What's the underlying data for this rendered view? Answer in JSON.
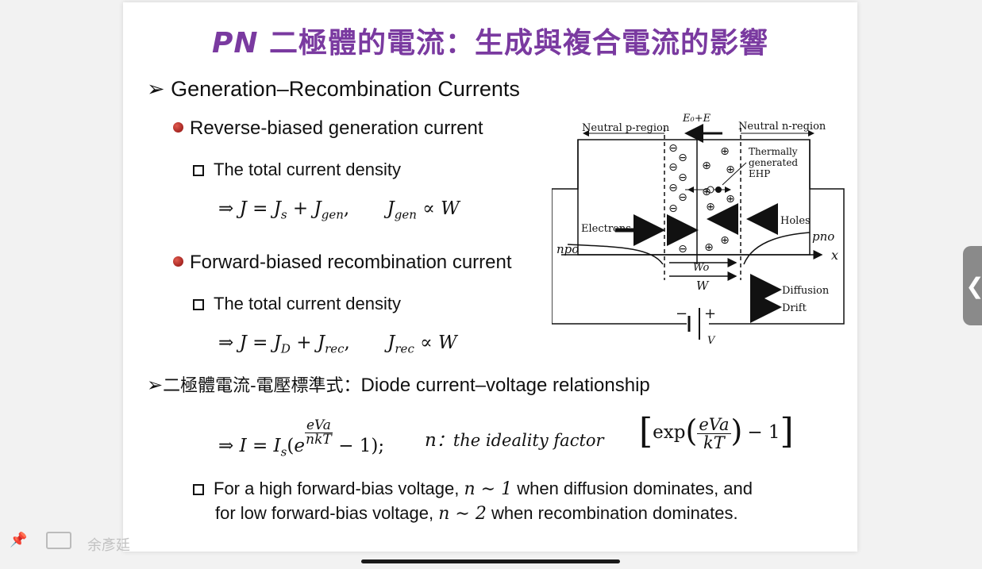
{
  "slide": {
    "title_pn": "PN",
    "title_rest": " 二極體的電流：生成與複合電流的影響",
    "heading": "Generation–Recombination Currents",
    "reverse": {
      "label": "Reverse-biased generation current",
      "sub": "The total current density",
      "eq_main": "⇒ J = J",
      "eq_s": "s",
      "eq_plus": " + J",
      "eq_gen": "gen",
      "eq_prop": "J",
      "eq_prop_sub": "gen",
      "eq_prop_rest": " ∝ W"
    },
    "forward": {
      "label": "Forward-biased recombination current",
      "sub": "The total current density",
      "eq_main": "⇒ J = J",
      "eq_D": "D",
      "eq_plus": " + J",
      "eq_rec": "rec",
      "eq_prop": "J",
      "eq_prop_sub": "rec",
      "eq_prop_rest": " ∝ W"
    },
    "diode_heading_cn": "二極體電流-電壓標準式：",
    "diode_heading_en": "Diode current–voltage relationship",
    "diode_eq_prefix": "⇒ I = I",
    "diode_eq_s": "s",
    "diode_eq_num": "eVa",
    "diode_eq_den": "nkT",
    "diode_eq_tail": " − 1);",
    "ideality_n": "n",
    "ideality_text": "：the ideality factor",
    "exp_text": "exp",
    "exp_num": "eVa",
    "exp_den": "kT",
    "exp_tail": "− 1",
    "note_line1_a": "For a high forward-bias voltage, ",
    "note_line1_n": "n ∼ 1",
    "note_line1_b": " when diffusion dominates, and",
    "note_line2_a": "for low forward-bias voltage, ",
    "note_line2_n": "n ∼ 2",
    "note_line2_b": " when recombination dominates."
  },
  "diagram": {
    "field_label": "E₀+E",
    "neutral_p": "Neutral p-region",
    "neutral_n": "Neutral n-region",
    "thermal": [
      "Thermally",
      "generated",
      "EHP"
    ],
    "electrons": "Electrons",
    "holes": "Holes",
    "npo": "npo",
    "pno": "pno",
    "x_axis": "x",
    "wo": "Wo",
    "w": "W",
    "diffusion": "Diffusion",
    "drift": "Drift",
    "v": "V",
    "minus": "−",
    "plus": "+"
  },
  "viewer": {
    "author": "余彥廷",
    "side_tab_glyph": "❮"
  }
}
